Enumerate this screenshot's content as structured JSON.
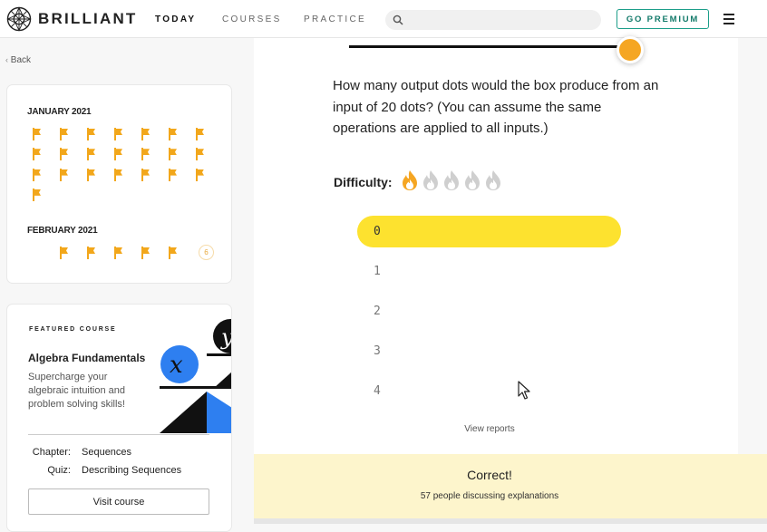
{
  "header": {
    "logo_text": "BRILLIANT",
    "nav": [
      {
        "label": "TODAY",
        "active": true
      },
      {
        "label": "COURSES",
        "active": false
      },
      {
        "label": "PRACTICE",
        "active": false
      }
    ],
    "search_placeholder": "",
    "premium_label": "GO PREMIUM",
    "accent_color": "#1d9e8a"
  },
  "sidebar": {
    "back_label": "Back",
    "calendar": {
      "months": [
        {
          "label": "JANUARY 2021",
          "completed_days": 22
        },
        {
          "label": "FEBRUARY 2021",
          "completed_days": 5,
          "current_day": "6"
        }
      ],
      "flag_color": "#f2a71b"
    },
    "featured": {
      "eyebrow": "FEATURED COURSE",
      "title": "Algebra Fundamentals",
      "description": "Supercharge your algebraic intuition and problem solving skills!",
      "art_symbols": [
        "x",
        "y"
      ],
      "chapter_label": "Chapter:",
      "chapter_value": "Sequences",
      "quiz_label": "Quiz:",
      "quiz_value": "Describing Sequences",
      "visit_label": "Visit course"
    }
  },
  "main": {
    "question": "How many output dots would the box produce from an input of 20 dots? (You can assume the same operations are applied to all inputs.)",
    "difficulty_label": "Difficulty:",
    "difficulty_level": 1,
    "difficulty_max": 5,
    "choices": [
      {
        "label": "0",
        "selected": true
      },
      {
        "label": "1",
        "selected": false
      },
      {
        "label": "2",
        "selected": false
      },
      {
        "label": "3",
        "selected": false
      },
      {
        "label": "4",
        "selected": false
      }
    ],
    "view_reports": "View reports",
    "result_title": "Correct!",
    "result_subtitle": "57 people discussing explanations",
    "selected_color": "#fde22f",
    "result_bg": "#fdf5cc"
  }
}
